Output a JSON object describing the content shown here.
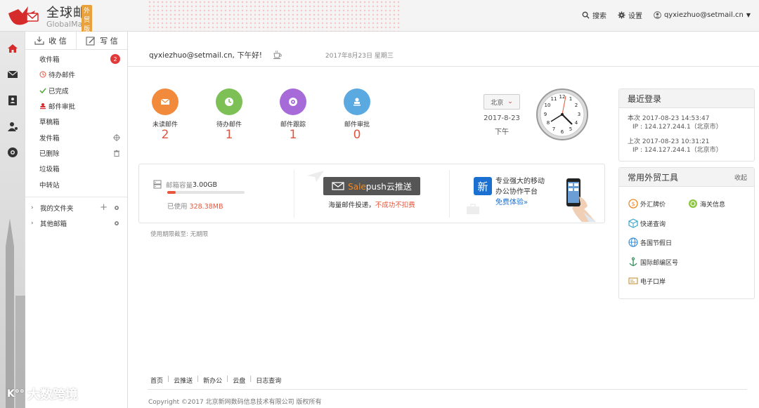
{
  "app": {
    "name_zh": "全球邮",
    "name_en": "GlobalMail",
    "edition_badge": "外贸版"
  },
  "top_links": {
    "search": "搜索",
    "settings": "设置",
    "account": "qyxiezhuo@setmail.cn"
  },
  "mailnav": {
    "receive_label": "收 信",
    "compose_label": "写 信",
    "items": [
      {
        "label": "收件箱",
        "count": "2"
      },
      {
        "label": "待办邮件"
      },
      {
        "label": "已完成"
      },
      {
        "label": "邮件审批"
      },
      {
        "label": "草稿箱"
      },
      {
        "label": "发件箱"
      },
      {
        "label": "已删除"
      },
      {
        "label": "垃圾箱"
      },
      {
        "label": "中转站"
      }
    ],
    "folders": [
      {
        "label": "我的文件夹"
      },
      {
        "label": "其他邮箱"
      }
    ]
  },
  "watermark": "大数跨境",
  "greeting": {
    "text": "qyxiezhuo@setmail.cn, 下午好!",
    "date": "2017年8月23日 星期三"
  },
  "stats": [
    {
      "label": "未读邮件",
      "value": "2",
      "color": "#f28a3c",
      "icon": "envelope-icon"
    },
    {
      "label": "待办邮件",
      "value": "1",
      "color": "#7cc056",
      "icon": "clock-icon"
    },
    {
      "label": "邮件跟踪",
      "value": "1",
      "color": "#a66bd8",
      "icon": "target-icon"
    },
    {
      "label": "邮件审批",
      "value": "0",
      "color": "#5aa9e0",
      "icon": "stamp-icon"
    }
  ],
  "clock_widget": {
    "city": "北京",
    "date": "2017-8-23",
    "period": "下午"
  },
  "capacity": {
    "label": "邮箱容量",
    "total": "3.00GB",
    "used_label": "已使用",
    "used": "328.38MB",
    "used_fraction": 0.11
  },
  "salepush": {
    "brand_a": "Sale",
    "brand_b": "push",
    "brand_c": "云推送",
    "desc_a": "海量邮件投递，",
    "desc_b": "不成功不扣费"
  },
  "xin": {
    "glyph": "新",
    "line1": "专业强大的移动",
    "line2": "办公协作平台",
    "link": "免费体验»"
  },
  "expiry": "使用期限截至: 无期限",
  "last_login": {
    "title": "最近登录",
    "rows": [
      {
        "time": "本次 2017-08-23 14:53:47",
        "ip": "IP : 124.127.244.1（北京市）"
      },
      {
        "time": "上次 2017-08-23 10:31:21",
        "ip": "IP : 124.127.244.1（北京市）"
      }
    ]
  },
  "tools": {
    "title": "常用外贸工具",
    "fold": "收起",
    "items": [
      {
        "label": "外汇牌价",
        "icon": "currency-icon"
      },
      {
        "label": "海关信息",
        "icon": "customs-icon"
      },
      {
        "label": "快递查询",
        "icon": "box-icon"
      },
      {
        "label": "各国节假日",
        "icon": "globe-icon"
      },
      {
        "label": "国际邮编区号",
        "icon": "anchor-icon"
      },
      {
        "label": "电子口岸",
        "icon": "card-icon"
      }
    ]
  },
  "footer": {
    "links": [
      "首页",
      "云推送",
      "新办公",
      "云盘",
      "日志查询"
    ],
    "copyright": "Copyright ©2017 北京新网数码信息技术有限公司 版权所有"
  }
}
